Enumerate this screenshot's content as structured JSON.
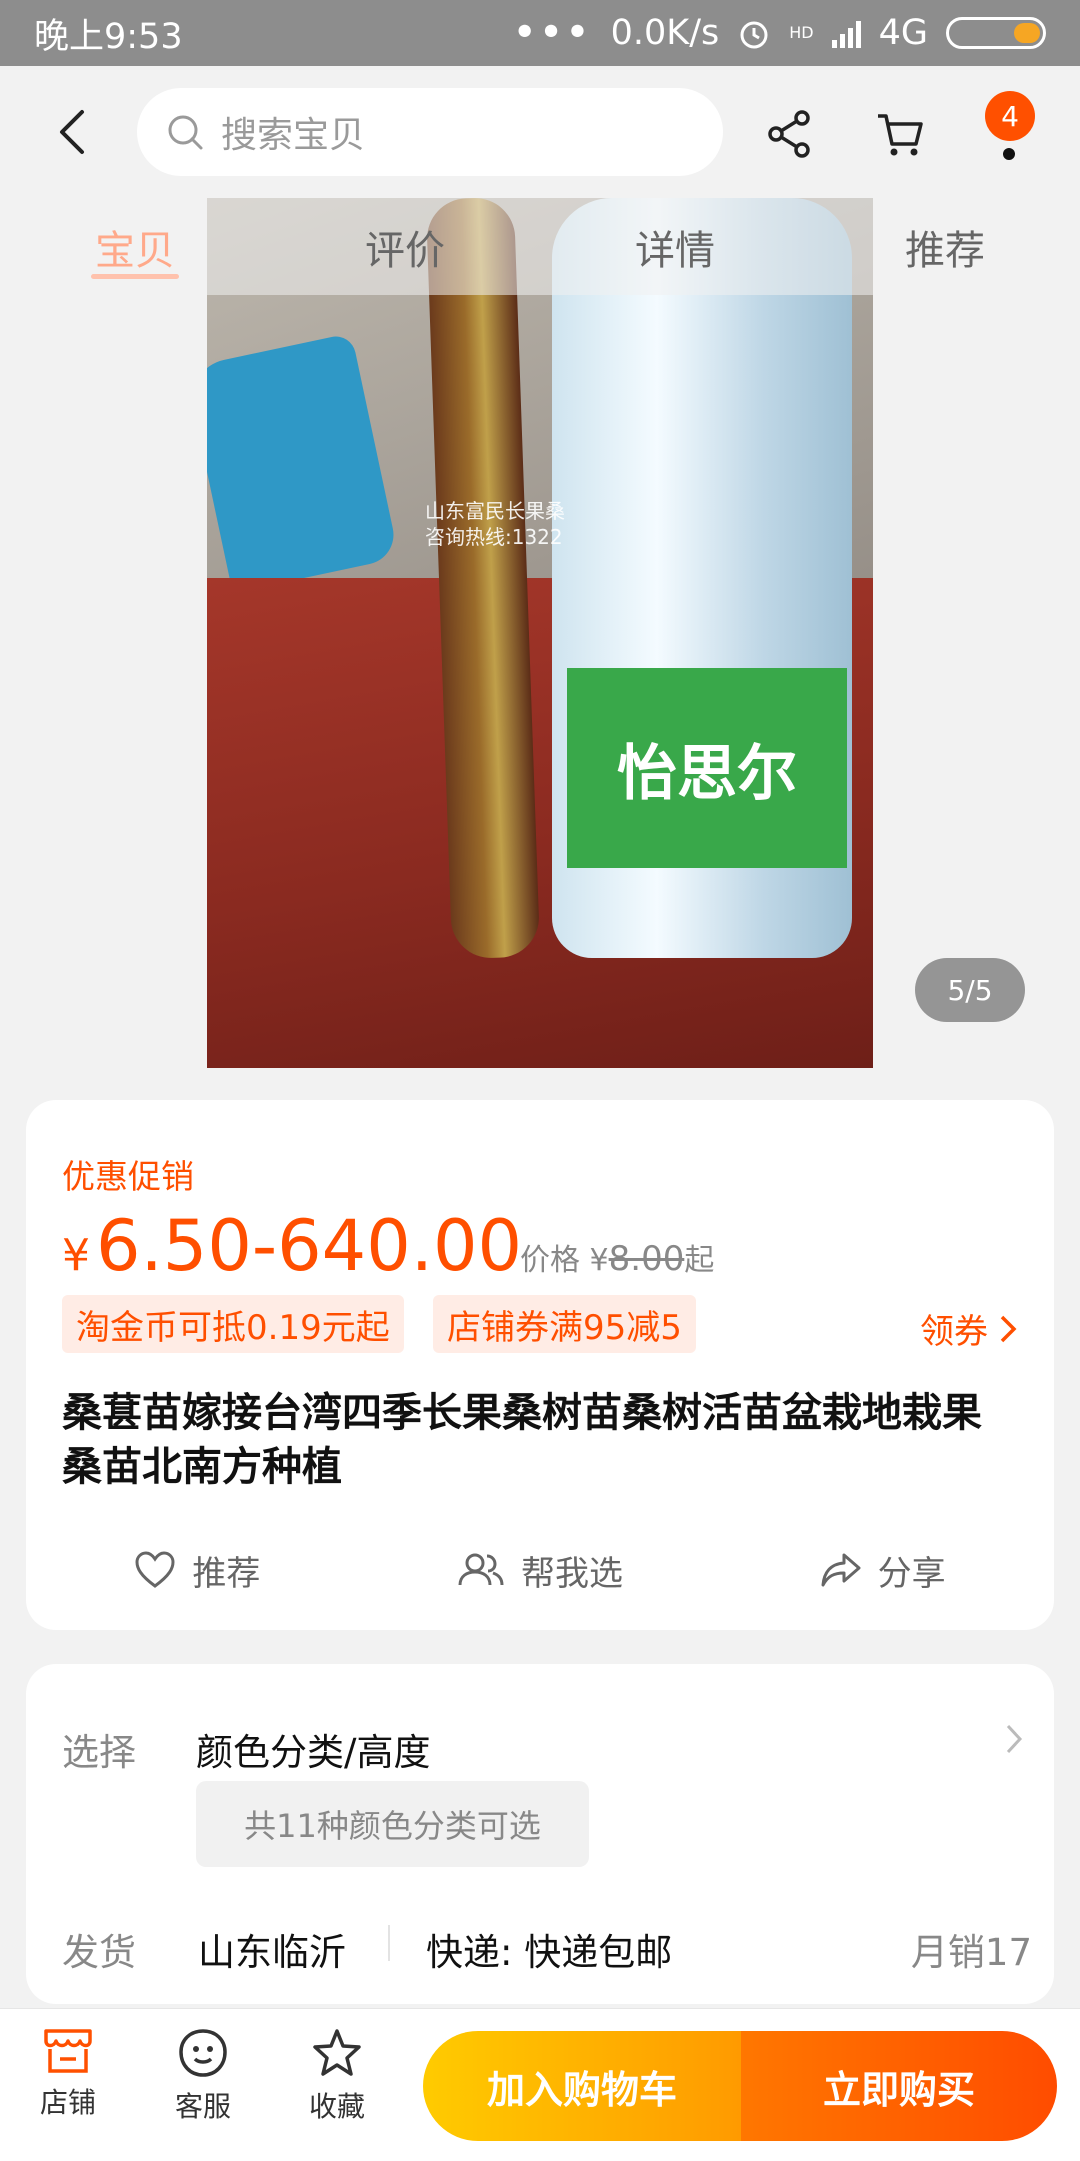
{
  "status": {
    "time": "晚上9:53",
    "speed": "0.0K/s",
    "network": "4G",
    "hd": "HD"
  },
  "search": {
    "placeholder": "搜索宝贝"
  },
  "cart_badge": "4",
  "tabs": [
    {
      "label": "宝贝",
      "active": true
    },
    {
      "label": "评价",
      "active": false
    },
    {
      "label": "详情",
      "active": false
    },
    {
      "label": "推荐",
      "active": false
    }
  ],
  "gallery": {
    "pager": "5/5",
    "watermark_line1": "山东富民长果桑",
    "watermark_line2": "咨询热线:1322",
    "bottle_label": "怡思尔"
  },
  "product": {
    "promo_label": "优惠促销",
    "currency": "¥",
    "price_range": "6.50-640.00",
    "orig_prefix": "价格 ¥",
    "orig_price": "8.00",
    "orig_suffix": "起",
    "coupons": [
      "淘金币可抵0.19元起",
      "店铺券满95减5"
    ],
    "get_coupon": "领券",
    "title": "桑葚苗嫁接台湾四季长果桑树苗桑树活苗盆栽地栽果桑苗北南方种植",
    "actions": {
      "recommend": "推荐",
      "help_choose": "帮我选",
      "share": "分享"
    }
  },
  "options": {
    "select_label": "选择",
    "select_value": "颜色分类/高度",
    "select_chip": "共11种颜色分类可选",
    "ship_label": "发货",
    "ship_from": "山东临沂",
    "express": "快递: 快递包邮",
    "monthly_sales": "月销17"
  },
  "bottom": {
    "store": "店铺",
    "service": "客服",
    "favorite": "收藏",
    "add_to_cart": "加入购物车",
    "buy_now": "立即购买"
  },
  "colors": {
    "accent": "#ff4f00",
    "cta_yellow": "#ffb800",
    "cta_orange": "#ff5a00"
  }
}
